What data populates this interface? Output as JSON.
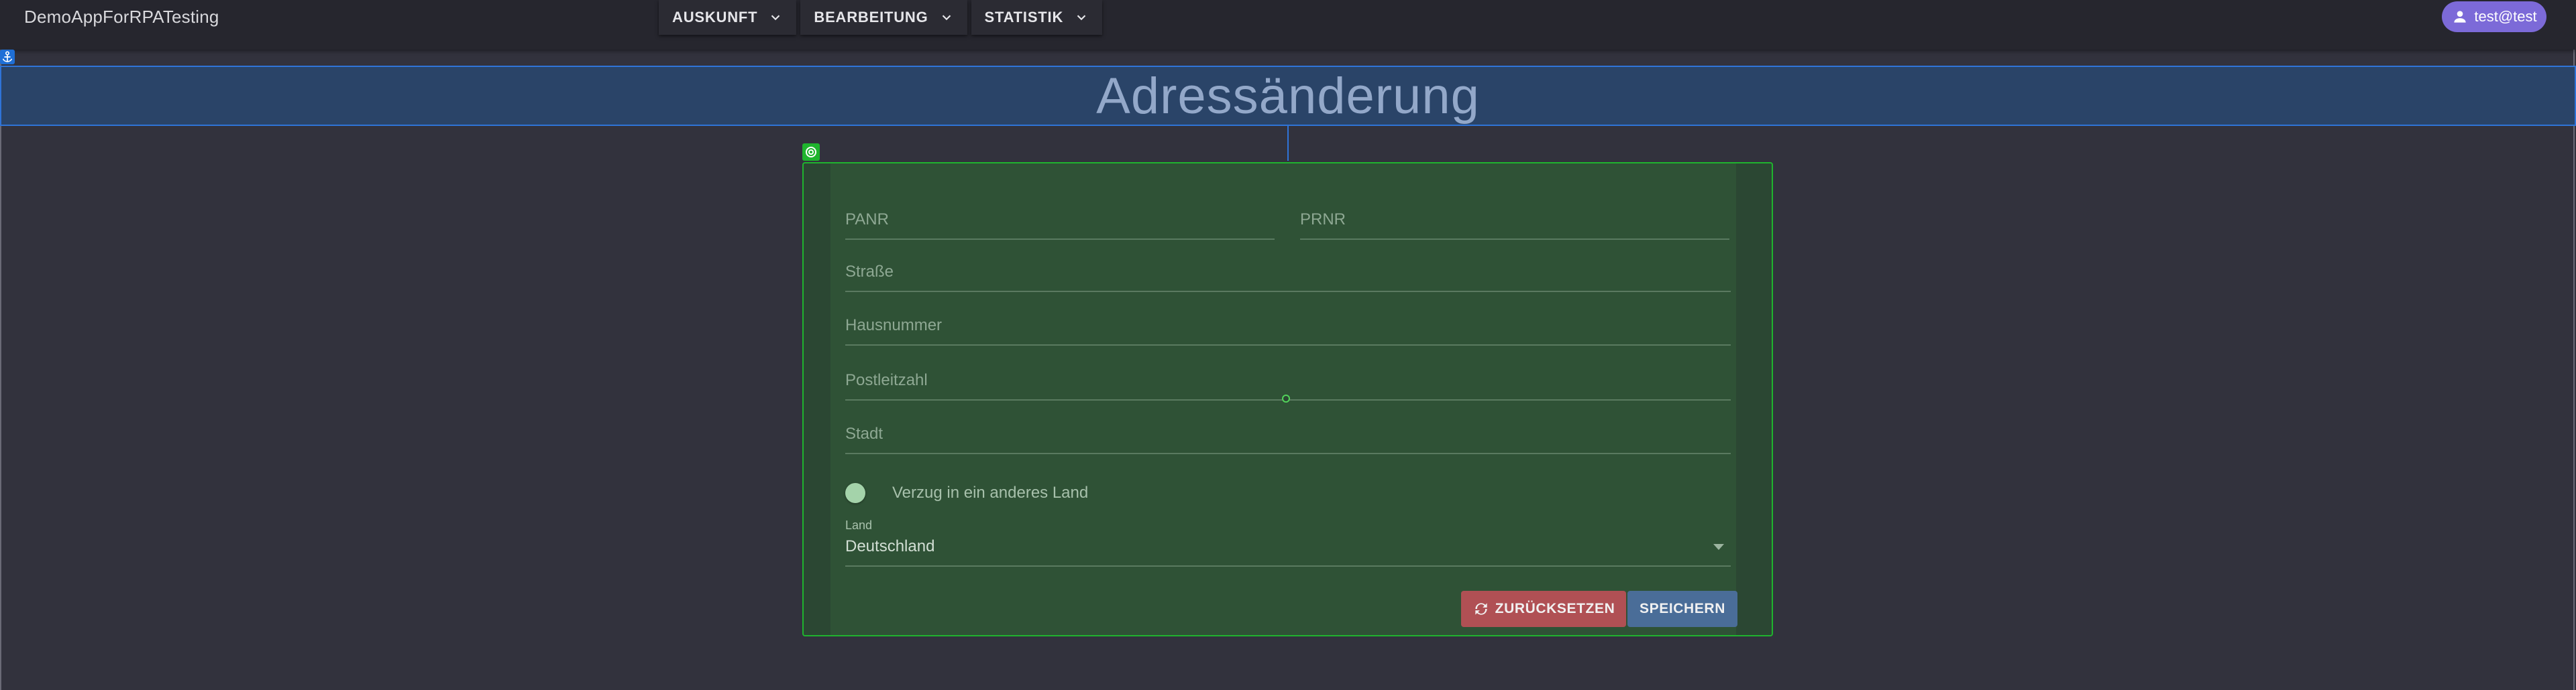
{
  "app": {
    "title": "DemoAppForRPATesting"
  },
  "nav": {
    "items": [
      {
        "label": "AUSKUNFT"
      },
      {
        "label": "BEARBEITUNG"
      },
      {
        "label": "STATISTIK"
      }
    ]
  },
  "user": {
    "label": "test@test",
    "icon": "person-icon"
  },
  "page": {
    "title": "Adressänderung"
  },
  "form": {
    "fields": {
      "panr": {
        "label": "PANR",
        "value": ""
      },
      "prnr": {
        "label": "PRNR",
        "value": ""
      },
      "strasse": {
        "label": "Straße",
        "value": ""
      },
      "hausnummer": {
        "label": "Hausnummer",
        "value": ""
      },
      "postleitzahl": {
        "label": "Postleitzahl",
        "value": ""
      },
      "stadt": {
        "label": "Stadt",
        "value": ""
      }
    },
    "toggle": {
      "label": "Verzug in ein anderes Land",
      "checked": false
    },
    "land": {
      "label": "Land",
      "value": "Deutschland"
    },
    "buttons": {
      "reset": "ZURÜCKSETZEN",
      "save": "SPEICHERN"
    }
  },
  "colors": {
    "accent_user": "#7c6ad8",
    "title_band": "#2a4468",
    "form_bg": "#2f5236",
    "form_border": "#1fb42e",
    "reset_button": "#b05054",
    "save_button": "#4a6d98"
  }
}
